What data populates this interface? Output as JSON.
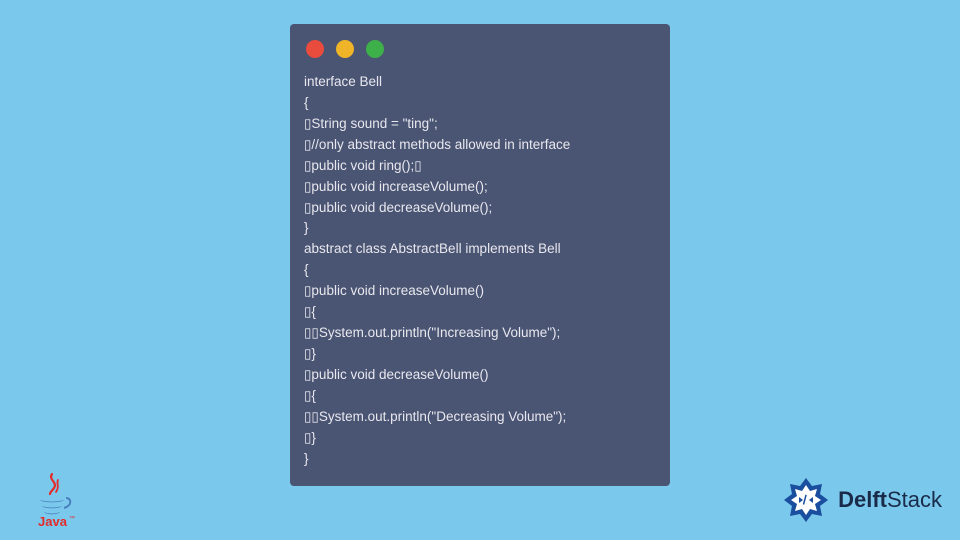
{
  "window": {
    "dots": [
      "red",
      "yellow",
      "green"
    ]
  },
  "code": {
    "lines": [
      "interface Bell",
      "{",
      "▯String sound = \"ting\";",
      "▯//only abstract methods allowed in interface",
      "▯public void ring();▯",
      "▯public void increaseVolume();",
      "▯public void decreaseVolume();",
      "}",
      "abstract class AbstractBell implements Bell",
      "{",
      "▯public void increaseVolume()",
      "▯{",
      "▯▯System.out.println(\"Increasing Volume\");",
      "▯}",
      "▯public void decreaseVolume()",
      "▯{",
      "▯▯System.out.println(\"Decreasing Volume\");",
      "▯}",
      "}"
    ]
  },
  "logos": {
    "java_label": "Java",
    "brand_name_part1": "Delft",
    "brand_name_part2": "Stack"
  },
  "colors": {
    "bg": "#7ac8ec",
    "window": "#4a5473",
    "code_text": "#e8e8ee",
    "java_red": "#e32b2b",
    "java_blue": "#4a7fbf",
    "brand_blue": "#1a4e9e"
  }
}
